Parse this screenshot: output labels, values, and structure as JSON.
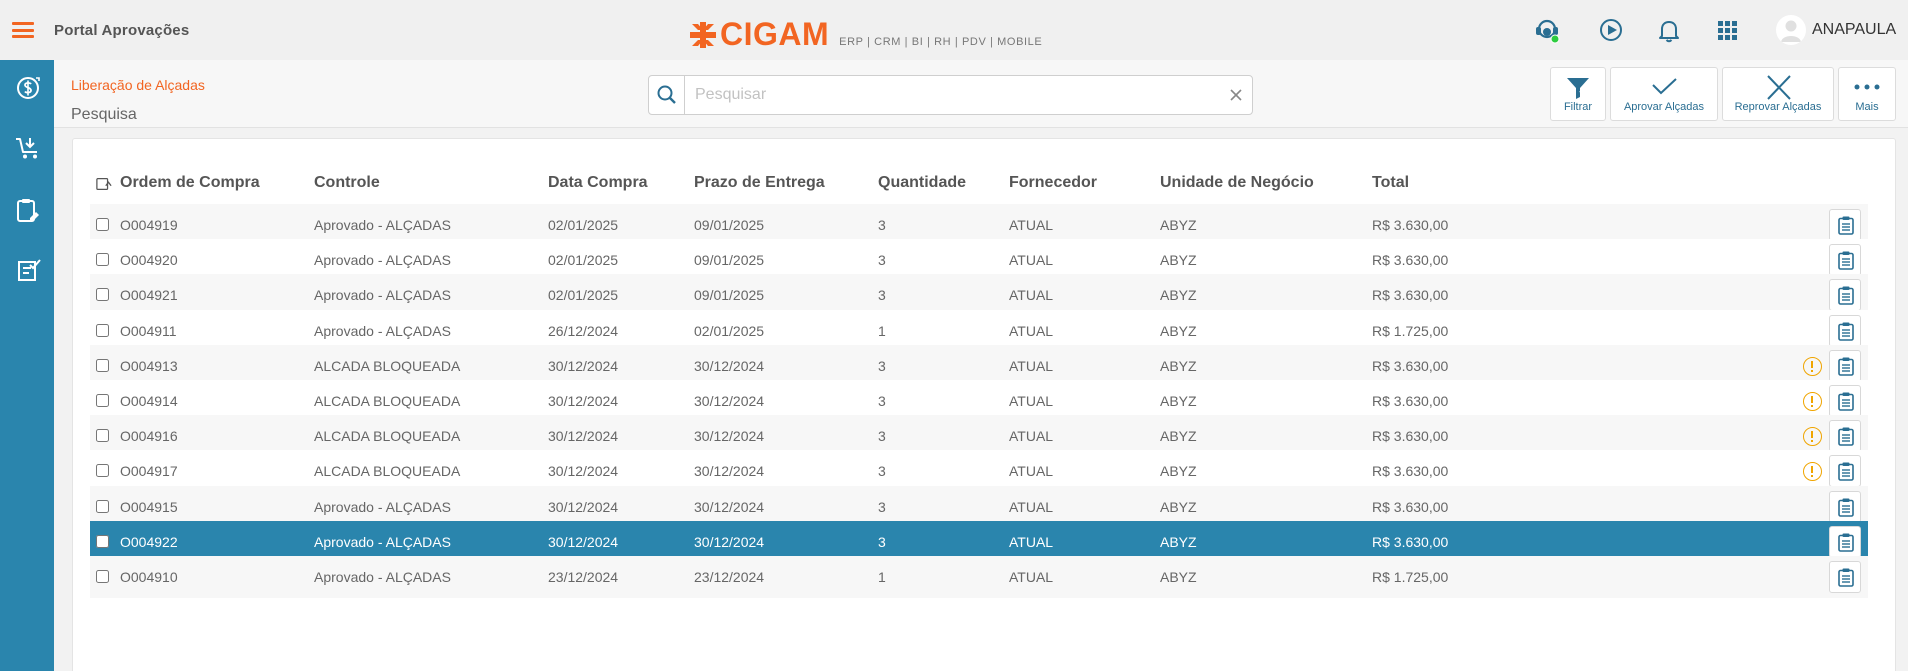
{
  "header": {
    "app_title": "Portal Aprovações",
    "brand_name": "CIGAM",
    "brand_tagline": "ERP | CRM | BI | RH | PDV | MOBILE",
    "user_name": "ANAPAULA",
    "icons": [
      "support-headset-icon",
      "play-circle-icon",
      "bell-icon",
      "apps-grid-icon",
      "user-avatar-icon"
    ]
  },
  "sidebar": {
    "items": [
      "finance-icon",
      "cart-download-icon",
      "clipboard-edit-icon",
      "checklist-icon"
    ]
  },
  "page": {
    "breadcrumb": "Liberação de Alçadas",
    "subtitle": "Pesquisa",
    "search_placeholder": "Pesquisar"
  },
  "toolbar": {
    "filter": "Filtrar",
    "approve": "Aprovar Alçadas",
    "reject": "Reprovar Alçadas",
    "more": "Mais"
  },
  "table": {
    "columns": [
      "Ordem de Compra",
      "Controle",
      "Data Compra",
      "Prazo de Entrega",
      "Quantidade",
      "Fornecedor",
      "Unidade de Negócio",
      "Total"
    ],
    "rows": [
      {
        "order": "O004919",
        "control": "Aprovado - ALÇADAS",
        "date": "02/01/2025",
        "deadline": "09/01/2025",
        "qty": "3",
        "supplier": "ATUAL",
        "unit": "ABYZ",
        "total": "R$ 3.630,00",
        "warning": false,
        "selected": false
      },
      {
        "order": "O004920",
        "control": "Aprovado - ALÇADAS",
        "date": "02/01/2025",
        "deadline": "09/01/2025",
        "qty": "3",
        "supplier": "ATUAL",
        "unit": "ABYZ",
        "total": "R$ 3.630,00",
        "warning": false,
        "selected": false
      },
      {
        "order": "O004921",
        "control": "Aprovado - ALÇADAS",
        "date": "02/01/2025",
        "deadline": "09/01/2025",
        "qty": "3",
        "supplier": "ATUAL",
        "unit": "ABYZ",
        "total": "R$ 3.630,00",
        "warning": false,
        "selected": false
      },
      {
        "order": "O004911",
        "control": "Aprovado - ALÇADAS",
        "date": "26/12/2024",
        "deadline": "02/01/2025",
        "qty": "1",
        "supplier": "ATUAL",
        "unit": "ABYZ",
        "total": "R$ 1.725,00",
        "warning": false,
        "selected": false
      },
      {
        "order": "O004913",
        "control": "ALCADA BLOQUEADA",
        "date": "30/12/2024",
        "deadline": "30/12/2024",
        "qty": "3",
        "supplier": "ATUAL",
        "unit": "ABYZ",
        "total": "R$ 3.630,00",
        "warning": true,
        "selected": false
      },
      {
        "order": "O004914",
        "control": "ALCADA BLOQUEADA",
        "date": "30/12/2024",
        "deadline": "30/12/2024",
        "qty": "3",
        "supplier": "ATUAL",
        "unit": "ABYZ",
        "total": "R$ 3.630,00",
        "warning": true,
        "selected": false
      },
      {
        "order": "O004916",
        "control": "ALCADA BLOQUEADA",
        "date": "30/12/2024",
        "deadline": "30/12/2024",
        "qty": "3",
        "supplier": "ATUAL",
        "unit": "ABYZ",
        "total": "R$ 3.630,00",
        "warning": true,
        "selected": false
      },
      {
        "order": "O004917",
        "control": "ALCADA BLOQUEADA",
        "date": "30/12/2024",
        "deadline": "30/12/2024",
        "qty": "3",
        "supplier": "ATUAL",
        "unit": "ABYZ",
        "total": "R$ 3.630,00",
        "warning": true,
        "selected": false
      },
      {
        "order": "O004915",
        "control": "Aprovado - ALÇADAS",
        "date": "30/12/2024",
        "deadline": "30/12/2024",
        "qty": "3",
        "supplier": "ATUAL",
        "unit": "ABYZ",
        "total": "R$ 3.630,00",
        "warning": false,
        "selected": false
      },
      {
        "order": "O004922",
        "control": "Aprovado - ALÇADAS",
        "date": "30/12/2024",
        "deadline": "30/12/2024",
        "qty": "3",
        "supplier": "ATUAL",
        "unit": "ABYZ",
        "total": "R$ 3.630,00",
        "warning": false,
        "selected": true
      },
      {
        "order": "O004910",
        "control": "Aprovado - ALÇADAS",
        "date": "23/12/2024",
        "deadline": "23/12/2024",
        "qty": "1",
        "supplier": "ATUAL",
        "unit": "ABYZ",
        "total": "R$ 1.725,00",
        "warning": false,
        "selected": false
      }
    ]
  },
  "colors": {
    "accent_orange": "#f26522",
    "sidebar_blue": "#2a85ad",
    "selected_row": "#2a85ad",
    "warning": "#f0a500",
    "status_online": "#2ecc40"
  }
}
